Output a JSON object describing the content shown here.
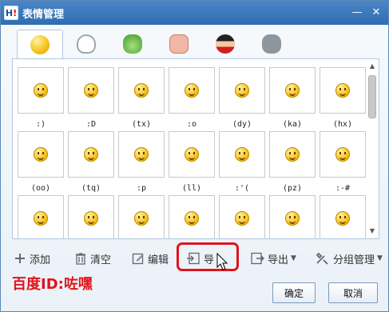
{
  "window": {
    "title": "表情管理"
  },
  "tabs": [
    {
      "icon": "smiley-face-icon"
    },
    {
      "icon": "white-bubble-icon"
    },
    {
      "icon": "green-frog-icon"
    },
    {
      "icon": "pink-pig-icon"
    },
    {
      "icon": "superhero-icon"
    },
    {
      "icon": "gray-cat-icon"
    }
  ],
  "emoticons": {
    "row1": [
      ":)",
      ":D",
      "(tx)",
      ":o",
      "(dy)",
      "(ka)",
      "(hx)"
    ],
    "row2": [
      "(oo)",
      "(tq)",
      ":p",
      "(ll)",
      ":'(",
      "(pz)",
      ":-#"
    ]
  },
  "toolbar": {
    "add": "添加",
    "clear": "清空",
    "edit": "编辑",
    "import": "导入",
    "import_visible": "导",
    "export": "导出",
    "group": "分组管理"
  },
  "watermark": "百度ID:咗嘿",
  "buttons": {
    "ok": "确定",
    "cancel": "取消"
  },
  "colors": {
    "title_bar": "#2f6db1",
    "highlight": "#e0141a"
  }
}
